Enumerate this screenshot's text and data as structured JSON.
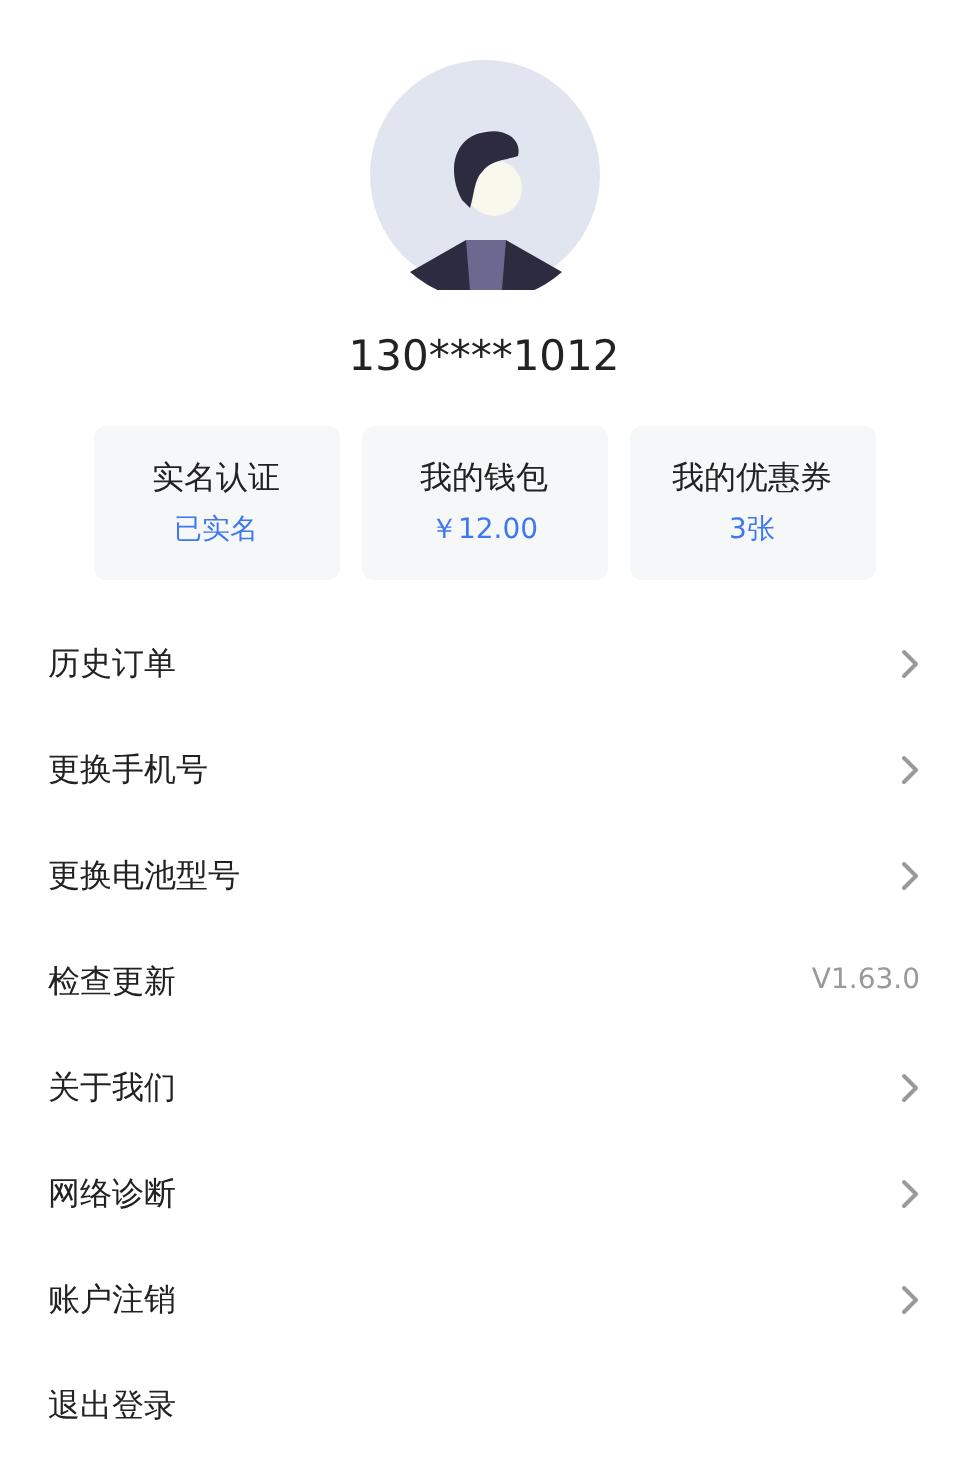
{
  "profile": {
    "phone": "130****1012"
  },
  "cards": [
    {
      "title": "实名认证",
      "value": "已实名"
    },
    {
      "title": "我的钱包",
      "value": "￥12.00"
    },
    {
      "title": "我的优惠券",
      "value": "3张"
    }
  ],
  "menu": [
    {
      "label": "历史订单",
      "kind": "chevron"
    },
    {
      "label": "更换手机号",
      "kind": "chevron"
    },
    {
      "label": "更换电池型号",
      "kind": "chevron"
    },
    {
      "label": "检查更新",
      "kind": "value",
      "value": "V1.63.0"
    },
    {
      "label": "关于我们",
      "kind": "chevron"
    },
    {
      "label": "网络诊断",
      "kind": "chevron"
    },
    {
      "label": "账户注销",
      "kind": "chevron"
    },
    {
      "label": "退出登录",
      "kind": "plain"
    }
  ]
}
